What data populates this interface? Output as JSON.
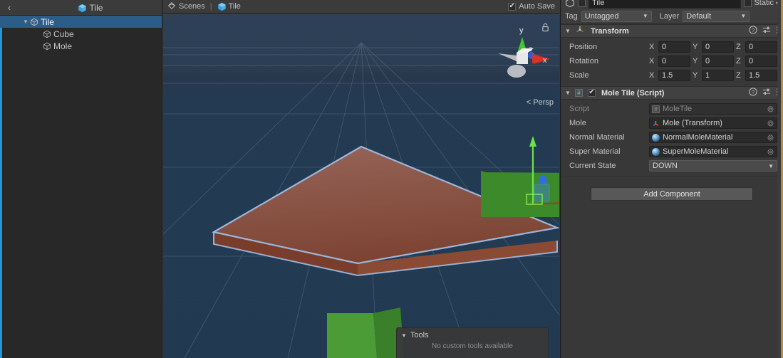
{
  "hierarchy": {
    "back_icon": "‹",
    "title": "Tile",
    "title_icon": "cube-icon",
    "items": [
      {
        "label": "Tile",
        "depth": 0,
        "expanded": true,
        "selected": true,
        "icon": "cube-icon"
      },
      {
        "label": "Cube",
        "depth": 1,
        "expanded": false,
        "selected": false,
        "icon": "cube-icon"
      },
      {
        "label": "Mole",
        "depth": 1,
        "expanded": false,
        "selected": false,
        "icon": "cube-icon"
      }
    ]
  },
  "scene": {
    "breadcrumb_scenes": "Scenes",
    "breadcrumb_divider": "|",
    "breadcrumb_scene_name": "Tile",
    "scenes_icon": "unity-scene-icon",
    "scene_icon": "cube-icon",
    "auto_save_label": "Auto Save",
    "auto_save_checked": true,
    "gizmo": {
      "axis_x": "x",
      "axis_y": "y",
      "axis_z": "z",
      "lock_icon": "lock-open-icon",
      "projection_label": "< Persp"
    },
    "tools_overlay": {
      "title": "Tools",
      "twisty": "▼",
      "message": "No custom tools available"
    },
    "colors": {
      "background_top": "#2f4158",
      "background_bottom": "#213a52",
      "grid": "#6d7d8e",
      "tile_top": "#8d5a4a",
      "tile_side": "#8a4a34",
      "selection_outline": "#98b9e0",
      "green_box": "#4f9c3a",
      "gizmo_x": "#e03a2a",
      "gizmo_y": "#5ad633",
      "gizmo_z": "#2f6ee0"
    }
  },
  "inspector": {
    "object_name": "Tile",
    "object_enabled": true,
    "static_label": "Static",
    "static_checked": false,
    "tag_label": "Tag",
    "tag_value": "Untagged",
    "layer_label": "Layer",
    "layer_value": "Default",
    "components": [
      {
        "title": "Transform",
        "icon": "transform-axis-icon",
        "expanded": true,
        "help_icon": "help-icon",
        "preset_icon": "preset-icon",
        "menu_icon": "kebab-menu-icon",
        "rows": [
          {
            "name": "Position",
            "type": "vec3",
            "x": "0",
            "y": "0",
            "z": "0"
          },
          {
            "name": "Rotation",
            "type": "vec3",
            "x": "0",
            "y": "0",
            "z": "0"
          },
          {
            "name": "Scale",
            "type": "vec3",
            "x": "1.5",
            "y": "1",
            "z": "1.5"
          }
        ]
      },
      {
        "title": "Mole Tile (Script)",
        "icon": "cs-script-icon",
        "expanded": true,
        "enabled": true,
        "help_icon": "help-icon",
        "preset_icon": "preset-icon",
        "menu_icon": "kebab-menu-icon",
        "rows": [
          {
            "name": "Script",
            "type": "object",
            "value": "MoleTile",
            "value_icon": "cs-script-icon",
            "disabled": true
          },
          {
            "name": "Mole",
            "type": "object",
            "value": "Mole (Transform)",
            "value_icon": "transform-axis-icon",
            "disabled": false
          },
          {
            "name": "Normal Material",
            "type": "object",
            "value": "NormalMoleMaterial",
            "value_icon": "material-sphere-icon",
            "disabled": false
          },
          {
            "name": "Super Material",
            "type": "object",
            "value": "SuperMoleMaterial",
            "value_icon": "material-sphere-icon",
            "disabled": false
          },
          {
            "name": "Current State",
            "type": "enum",
            "value": "DOWN"
          }
        ]
      }
    ],
    "add_component_label": "Add Component",
    "axis_labels": {
      "x": "X",
      "y": "Y",
      "z": "Z"
    }
  }
}
